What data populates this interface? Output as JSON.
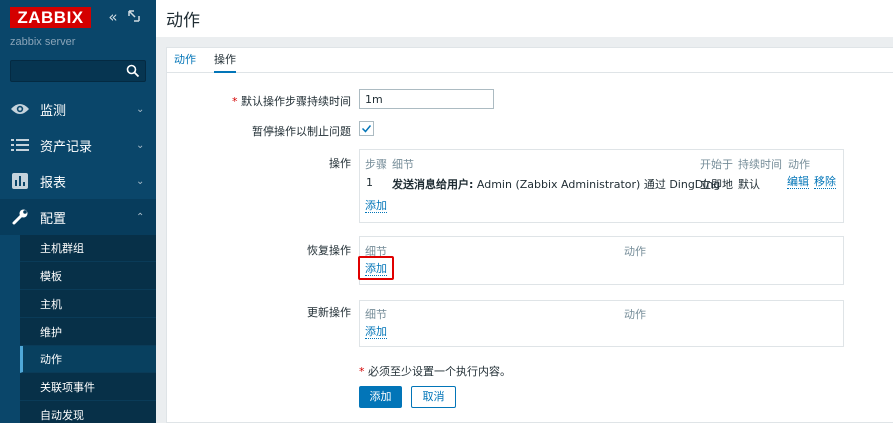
{
  "sidebar": {
    "logo": "ZABBIX",
    "server_name": "zabbix server",
    "search_placeholder": "",
    "nav": [
      {
        "label": "监测",
        "icon": "eye-icon"
      },
      {
        "label": "资产记录",
        "icon": "list-icon"
      },
      {
        "label": "报表",
        "icon": "bar-chart-icon"
      },
      {
        "label": "配置",
        "icon": "wrench-icon"
      }
    ],
    "submenu": [
      "主机群组",
      "模板",
      "主机",
      "维护",
      "动作",
      "关联项事件",
      "自动发现"
    ]
  },
  "header": {
    "title": "动作"
  },
  "tabs": [
    {
      "label": "动作"
    },
    {
      "label": "操作"
    }
  ],
  "form": {
    "step_duration_label": "默认操作步骤持续时间",
    "step_duration_value": "1m",
    "pause_label": "暂停操作以制止问题",
    "operations_label": "操作",
    "operations_headers": [
      "步骤",
      "细节",
      "开始于",
      "持续时间",
      "动作"
    ],
    "operations_row": {
      "step": "1",
      "detail_bold": "发送消息给用户:",
      "detail_rest": "Admin (Zabbix Administrator) 通过 DingDing",
      "start": "立即地",
      "duration": "默认",
      "edit": "编辑",
      "remove": "移除"
    },
    "operations_add": "添加",
    "recovery_label": "恢复操作",
    "recovery_headers": [
      "细节",
      "动作"
    ],
    "recovery_add": "添加",
    "update_label": "更新操作",
    "update_headers": [
      "细节",
      "动作"
    ],
    "update_add": "添加",
    "note": "必须至少设置一个执行内容。",
    "add_button": "添加",
    "cancel_button": "取消"
  },
  "colors": {
    "accent": "#0275b8",
    "sidebar": "#0a466a",
    "logo": "#d40000",
    "highlight": "#e00000"
  }
}
